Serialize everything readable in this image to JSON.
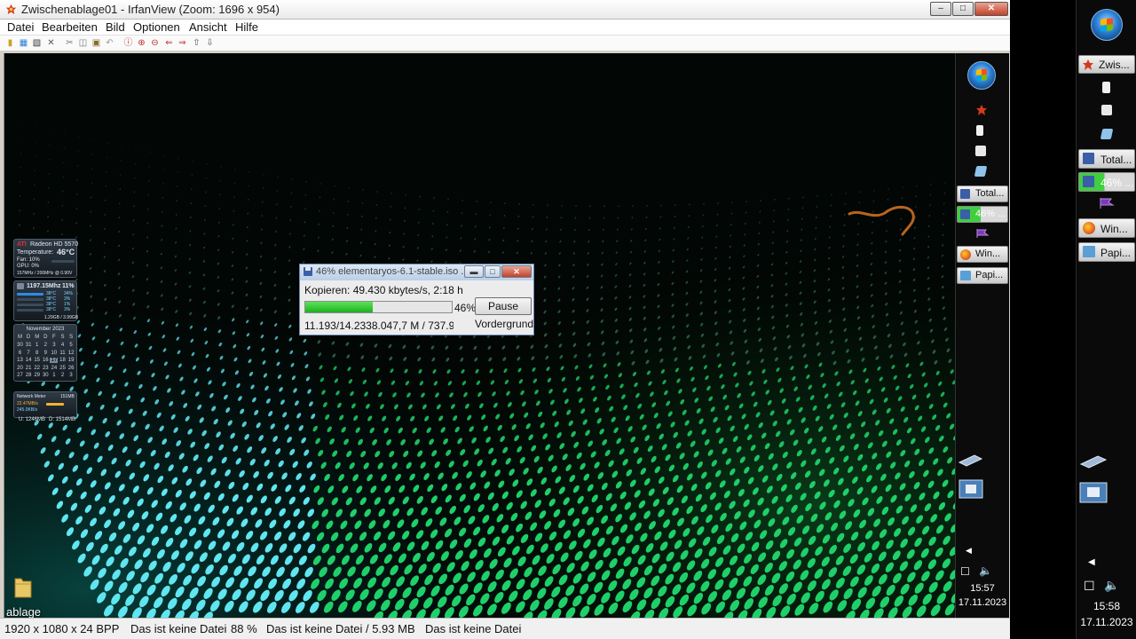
{
  "window": {
    "title": "Zwischenablage01 - IrfanView (Zoom: 1696 x 954)",
    "min_glyph": "–",
    "max_glyph": "□",
    "close_glyph": "✕"
  },
  "menu": [
    "Datei",
    "Bearbeiten",
    "Bild",
    "Optionen",
    "Ansicht",
    "Hilfe"
  ],
  "toolbar_icons": [
    "open-icon",
    "thumbnails-icon",
    "save-icon",
    "delete-icon",
    "cut-icon",
    "copy-icon",
    "paste-icon",
    "undo-icon",
    "info-icon",
    "zoom-in-icon",
    "zoom-out-icon",
    "prev-icon",
    "next-icon",
    "upload-icon",
    "download-icon"
  ],
  "status": {
    "dimensions": "1920 x 1080 x 24 BPP",
    "file": "Das ist keine Datei",
    "zoom": "88 %",
    "file_size": "Das ist keine Datei / 5.93 MB",
    "file2": "Das ist keine Datei"
  },
  "dialog": {
    "title": "46% elementaryos-6.1-stable.iso ...",
    "speed": "Kopieren: 49.430 kbytes/s, 2:18 h",
    "percent_label": "46%",
    "progress": 0.46,
    "bytes": "11.193/14.2338.047,7 M / 737.9 MB",
    "pause_label": "Pause",
    "foreground_label": "Vordergrund"
  },
  "desktop": {
    "folder_label": "ablage"
  },
  "gadgets": {
    "gpu_name": "Radeon HD 5570",
    "gpu_brand": "ATI",
    "temperature_label": "Temperature:",
    "temperature_value": "46°C",
    "fan": "Fan: 10%",
    "gpu_load": "GPU: 0%",
    "clocks": "157MHz / 200MHz @ 0.90V",
    "cpu_freq": "1197.15Mhz",
    "cpu_load": "11%",
    "cpu_cores": [
      "38°C",
      "38°C",
      "38°C",
      "38°C"
    ],
    "cpu_core_loads": [
      "34%",
      "3%",
      "1%",
      "3%"
    ],
    "ram": "1.29GB / 3.99GB",
    "calendar_month": "November 2023",
    "calendar_days": [
      "M",
      "D",
      "M",
      "D",
      "F",
      "S",
      "S"
    ],
    "calendar_weeks": [
      [
        "30",
        "31",
        "1",
        "2",
        "3",
        "4",
        "5"
      ],
      [
        "6",
        "7",
        "8",
        "9",
        "10",
        "11",
        "12"
      ],
      [
        "13",
        "14",
        "15",
        "16",
        "17",
        "18",
        "19"
      ],
      [
        "20",
        "21",
        "22",
        "23",
        "24",
        "25",
        "26"
      ],
      [
        "27",
        "28",
        "29",
        "30",
        "1",
        "2",
        "3"
      ]
    ],
    "net_title": "Network Meter",
    "net_total": "151MB",
    "net_down_rate": "22.47MB/s",
    "net_up_rate": "245.0KB/s",
    "net_up_total": "U: 1246MB",
    "net_down_total": "D: 1514MB"
  },
  "inner_taskbar": {
    "buttons": [
      {
        "label": "Total...",
        "icon": "disk-icon"
      },
      {
        "label": "46% ...",
        "icon": "disk-icon",
        "progress": 0.46
      },
      {
        "label": "Win...",
        "icon": "firefox-icon"
      },
      {
        "label": "Papi...",
        "icon": "paper-icon"
      }
    ],
    "time": "15:57",
    "date": "17.11.2023"
  },
  "real_taskbar": {
    "buttons": [
      {
        "label": "Zwis...",
        "icon": "irfanview-icon"
      },
      {
        "label": "Total...",
        "icon": "disk-icon"
      },
      {
        "label": "46% ...",
        "icon": "disk-icon",
        "progress": 0.46
      },
      {
        "label": "Win...",
        "icon": "firefox-icon"
      },
      {
        "label": "Papi...",
        "icon": "paper-icon"
      }
    ],
    "time": "15:58",
    "date": "17.11.2023"
  },
  "colors": {
    "progress_green": "#3fcf3f",
    "wallpaper_cyan": "#5fe6f0",
    "wallpaper_green": "#1fd06a",
    "annotation_orange": "#b8641e"
  }
}
